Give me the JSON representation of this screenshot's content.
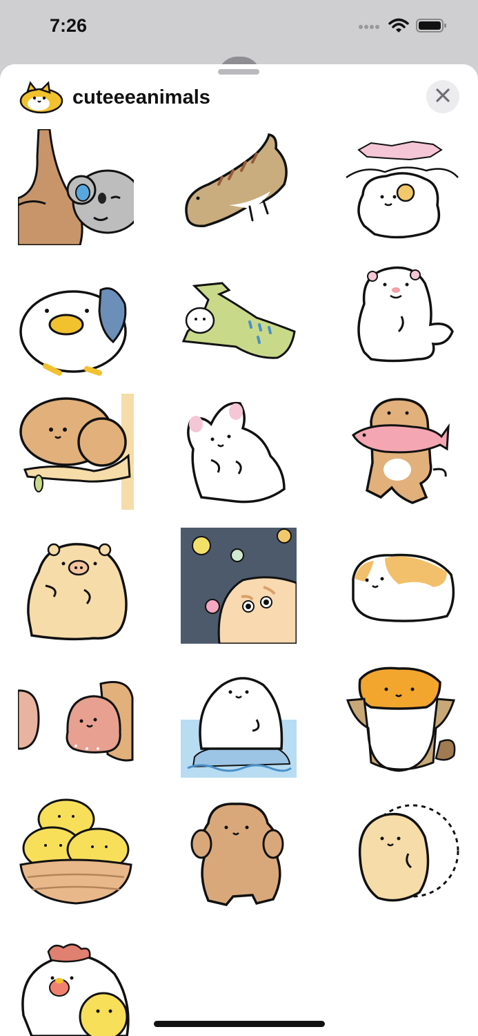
{
  "status_bar": {
    "time": "7:26",
    "icons": [
      "cellular-dots-icon",
      "wifi-icon",
      "battery-icon"
    ]
  },
  "header": {
    "app_name": "cuteeeanimals",
    "app_icon": "shiba-dog-icon",
    "close_icon": "close-icon"
  },
  "stickers": [
    {
      "name": "koala-on-tree-sticker"
    },
    {
      "name": "lizard-sticker"
    },
    {
      "name": "sheep-sticker"
    },
    {
      "name": "duck-with-fish-sticker"
    },
    {
      "name": "crocodile-with-bird-sticker"
    },
    {
      "name": "polar-bear-sticker"
    },
    {
      "name": "brown-bear-on-branch-sticker"
    },
    {
      "name": "rabbit-sticker"
    },
    {
      "name": "otter-with-fish-sticker"
    },
    {
      "name": "pig-sticker"
    },
    {
      "name": "hamster-bubbles-sticker"
    },
    {
      "name": "guinea-pig-sticker"
    },
    {
      "name": "octopus-sticker"
    },
    {
      "name": "seal-on-ice-sticker"
    },
    {
      "name": "raccoon-in-bag-sticker"
    },
    {
      "name": "chicks-in-basket-sticker"
    },
    {
      "name": "poodle-sticker"
    },
    {
      "name": "hedgehog-sticker"
    },
    {
      "name": "hen-with-chick-sticker"
    }
  ],
  "colors": {
    "sheet_background": "#ffffff",
    "page_background": "#cfcfd2",
    "outline": "#111111"
  }
}
